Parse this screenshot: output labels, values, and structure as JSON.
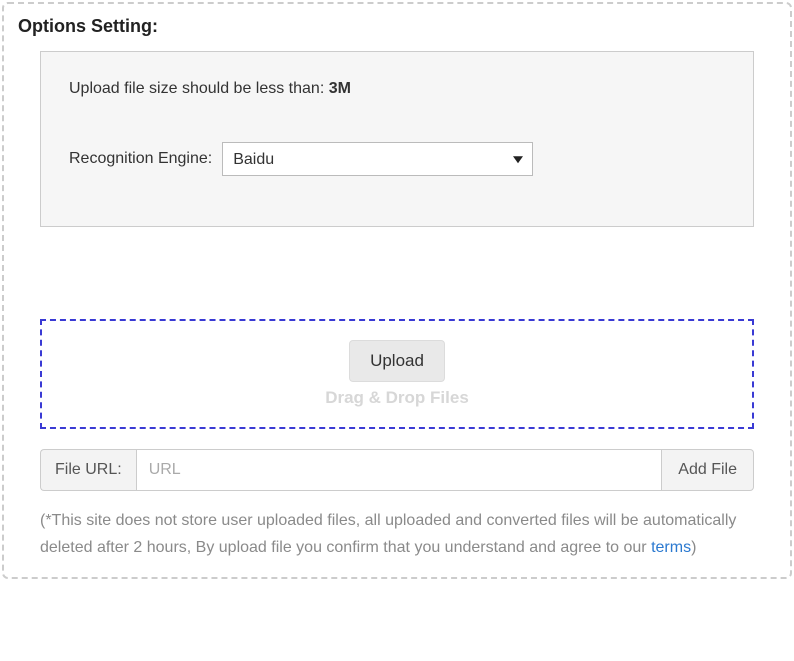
{
  "section_title": "Options Setting:",
  "options": {
    "upload_note_prefix": "Upload file size should be less than: ",
    "upload_limit": "3M",
    "engine_label": "Recognition Engine:",
    "engine_selected": "Baidu"
  },
  "dropzone": {
    "upload_button": "Upload",
    "hint": "Drag & Drop Files"
  },
  "url_row": {
    "label": "File URL:",
    "placeholder": "URL",
    "value": "",
    "add_button": "Add File"
  },
  "disclaimer": {
    "text_before": "(*This site does not store user uploaded files, all uploaded and converted files will be automatically deleted after 2 hours, By upload file you confirm that you understand and agree to our ",
    "terms_label": "terms",
    "text_after": ")"
  }
}
